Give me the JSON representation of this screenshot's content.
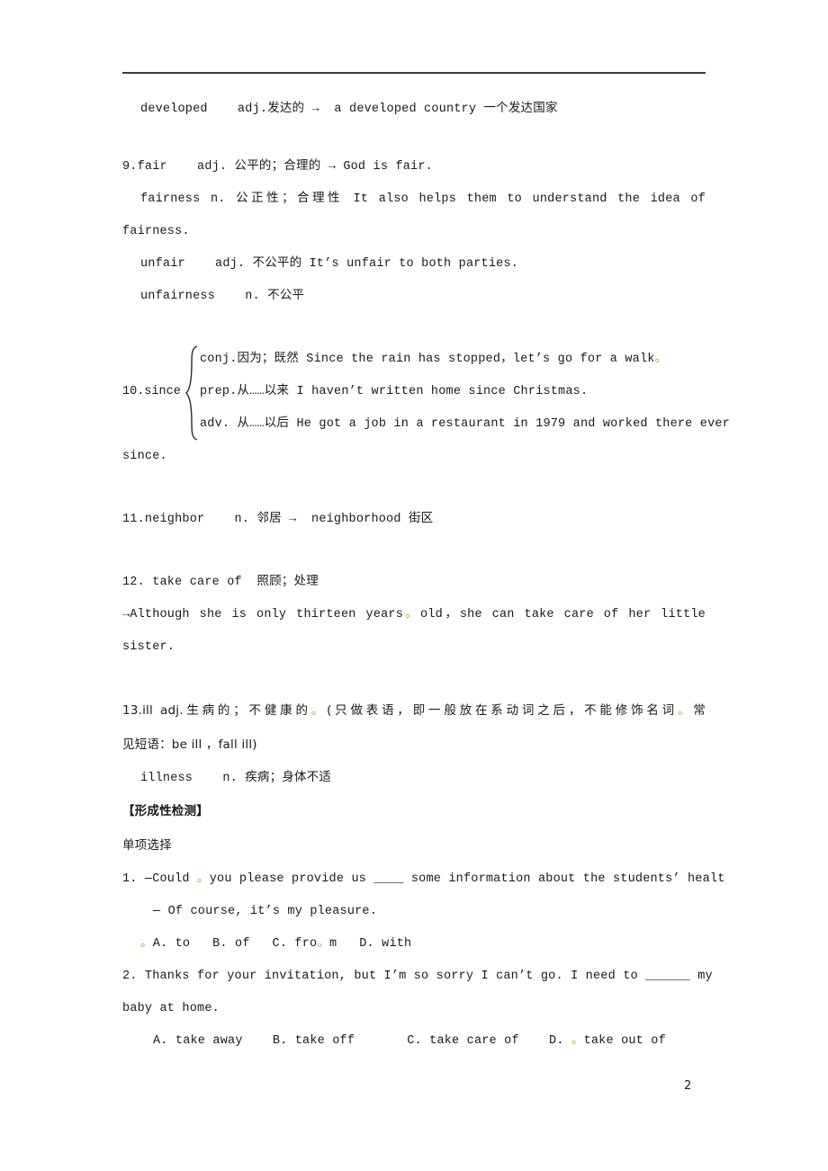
{
  "document": {
    "page_number": "2",
    "header_rule": true,
    "mark_color": "#b8a31c",
    "text_color": "#1a1a1a"
  },
  "entries": {
    "developed": {
      "word": "developed",
      "pos": "adj.",
      "cn": "发达的",
      "arrow": "→",
      "example": "a developed country",
      "example_cn": "一个发达国家",
      "full": "developed    adj.发达的 →  a developed country 一个发达国家"
    },
    "fair": {
      "number": "9.",
      "word": "fair",
      "pos": "adj.",
      "cn_a": "公平的",
      "mark": "。",
      "cn_b": "；合理的",
      "arrow": "→",
      "example": "God is fair.",
      "full": "9.fair    adj. 公平的；合理的 → God is fair."
    },
    "fairness": {
      "word": "fairness",
      "pos": "n.",
      "cn": "公正性；合理性",
      "example_part1": "It also helps them to understand the idea of",
      "example_part2": "fairness.",
      "full_line1": "fairness    n. 公正性；合理性 It also helps them to understand the idea of",
      "full_line2": "fairness."
    },
    "unfair": {
      "word": "unfair",
      "pos": "adj.",
      "cn": "不公平的",
      "example": "It’s unfair to both parties.",
      "full": "unfair    adj. 不公平的 It’s unfair to both parties."
    },
    "unfairness": {
      "word": "unfairness",
      "pos": "n.",
      "cn": "不公平",
      "full": "unfairness    n. 不公平"
    },
    "since": {
      "number": "10.",
      "word": "since",
      "label": "10.since",
      "senses": [
        {
          "pos": "conj.",
          "cn": "因为；既然",
          "example": "Since the rain has stopped, let’s go for a walk",
          "mark": "。",
          "full": "conj.因为；既然 Since the rain has stopped，let’s go for a walk。"
        },
        {
          "pos": "prep.",
          "cn": "从……以来",
          "example": "I haven’t written home since Christmas.",
          "full": "prep.从……以来 I haven’t written home since Christmas."
        },
        {
          "pos": "adv.",
          "cn": "从……以后",
          "example": "He got a job in a restaurant in 1979 and worked there ever",
          "full": "adv. 从……以后 He got a job in a restaurant in 1979 and worked there ever"
        }
      ],
      "continuation": "since."
    },
    "neighbor": {
      "number": "11.",
      "word": "neighbor",
      "pos": "n.",
      "cn": "邻居",
      "arrow": "→",
      "derived": "neighborhood",
      "derived_cn": "街区",
      "full": "11.neighbor    n. 邻居 →  neighborhood 街区"
    },
    "take_care_of": {
      "number": "12.",
      "phrase": "take care of",
      "cn": "照顾；处理",
      "full": "12. take care of  照顾；处理",
      "example_line1": "→Although she is only thirteen years。old，she can take care of her little",
      "example_line2": "sister."
    },
    "ill": {
      "number": "13.",
      "word": "ill",
      "pos": "adj.",
      "cn": "生病的；不健康的",
      "note_line1": "13.ill   adj.生病的；不健康的。(只做表语，即一般放在系动词之后，不能修饰名词。常",
      "note_line2": "见短语：be ill ，fall ill)"
    },
    "illness": {
      "word": "illness",
      "pos": "n.",
      "cn": "疾病；身体不适",
      "full": "illness    n. 疾病；身体不适"
    }
  },
  "quiz": {
    "section_title": "【形成性检测】",
    "subsection_title": "单项选择",
    "questions": [
      {
        "number": "1.",
        "stem_line1": "1. —Could 。you please provide us ____ some information about the students’ healt",
        "stem_line2": "— Of course, it’s my pleasure.",
        "options_line": "。A. to   B. of   C. fro。m   D. with",
        "options": [
          "A. to",
          "B. of",
          "C. from",
          "D. with"
        ]
      },
      {
        "number": "2.",
        "stem_line1": "2. Thanks for your invitation, but I’m so sorry I can’t go. I need to ______ my",
        "stem_line2": "baby at home.",
        "options_line": "A. take away    B. take off       C. take care of    D. 。take out of",
        "options": [
          "A. take away",
          "B. take off",
          "C. take care of",
          "D. take out of"
        ]
      }
    ]
  }
}
